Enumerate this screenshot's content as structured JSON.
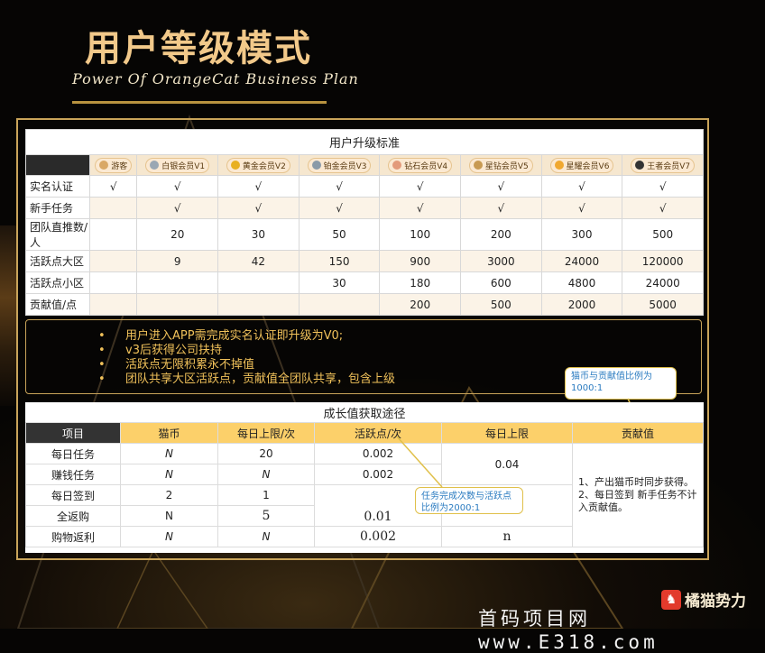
{
  "header": {
    "title": "用户等级模式",
    "subtitle": "Power Of OrangeCat Business Plan"
  },
  "upgrade_table": {
    "caption": "用户升级标准",
    "levels": [
      {
        "label": "游客",
        "icon": "visitor-icon",
        "color": "#d9a865"
      },
      {
        "label": "白银会员V1",
        "icon": "silver-icon",
        "color": "#9aa7b3"
      },
      {
        "label": "黄金会员V2",
        "icon": "gold-icon",
        "color": "#e8b020"
      },
      {
        "label": "铂金会员V3",
        "icon": "platinum-icon",
        "color": "#8a9aa8"
      },
      {
        "label": "钻石会员V4",
        "icon": "diamond-icon",
        "color": "#e39a7a"
      },
      {
        "label": "星钻会员V5",
        "icon": "star-diamond-icon",
        "color": "#c89a52"
      },
      {
        "label": "星耀会员V6",
        "icon": "star-shine-icon",
        "color": "#f0a830"
      },
      {
        "label": "王者会员V7",
        "icon": "king-icon",
        "color": "#333333"
      }
    ],
    "rows": [
      {
        "label": "实名认证",
        "cells": [
          "√",
          "√",
          "√",
          "√",
          "√",
          "√",
          "√",
          "√"
        ]
      },
      {
        "label": "新手任务",
        "cells": [
          "",
          "√",
          "√",
          "√",
          "√",
          "√",
          "√",
          "√"
        ]
      },
      {
        "label": "团队直推数/人",
        "cells": [
          "",
          "20",
          "30",
          "50",
          "100",
          "200",
          "300",
          "500"
        ]
      },
      {
        "label": "活跃点大区",
        "cells": [
          "",
          "9",
          "42",
          "150",
          "900",
          "3000",
          "24000",
          "120000"
        ]
      },
      {
        "label": "活跃点小区",
        "cells": [
          "",
          "",
          "",
          "30",
          "180",
          "600",
          "4800",
          "24000"
        ]
      },
      {
        "label": "贡献值/点",
        "cells": [
          "",
          "",
          "",
          "",
          "200",
          "500",
          "2000",
          "5000"
        ]
      }
    ]
  },
  "bullets": [
    "用户进入APP需完成实名认证即升级为V0;",
    "v3后获得公司扶持",
    "活跃点无限积累永不掉值",
    "团队共享大区活跃点，贡献值全团队共享，包含上级"
  ],
  "callouts": {
    "contribution_ratio": "猫币与贡献值比例为1000:1",
    "task_ratio": "任务完成次数与活跃点比例为2000:1"
  },
  "growth_table": {
    "caption": "成长值获取途径",
    "headers": [
      "项目",
      "猫币",
      "每日上限/次",
      "活跃点/次",
      "每日上限",
      "贡献值"
    ],
    "rows": [
      {
        "item": "每日任务",
        "coin": "N",
        "limit": "20",
        "points": "0.002"
      },
      {
        "item": "赚钱任务",
        "coin": "N",
        "limit": "N",
        "points": "0.002"
      },
      {
        "item": "每日签到",
        "coin": "2",
        "limit": "1",
        "points": ""
      },
      {
        "item": "全返购",
        "coin": "N",
        "limit": "5",
        "points": "0.01"
      },
      {
        "item": "购物返利",
        "coin": "N",
        "limit": "N",
        "points": "0.002"
      }
    ],
    "daily_limit_top": "0.04",
    "daily_limit_bottom": "n",
    "contribution_note_1": "1、产出猫币时同步获得。",
    "contribution_note_2": "2、每日签到 新手任务不计入贡献值。"
  },
  "footer": {
    "watermark": "首码项目网 www.E318.com",
    "logo_text": "橘猫势力"
  }
}
